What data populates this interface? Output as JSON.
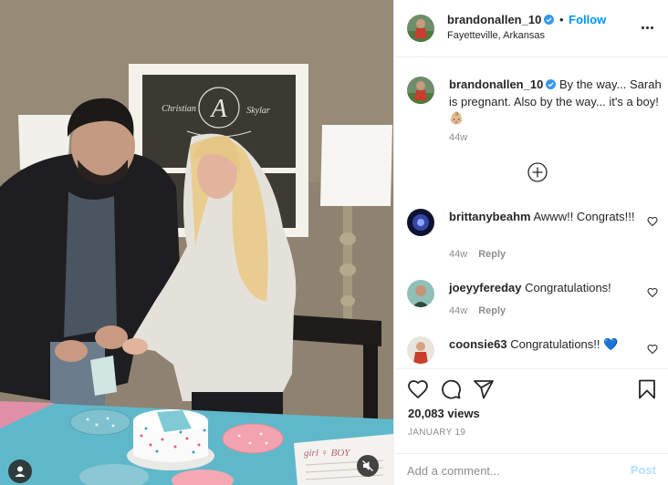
{
  "post": {
    "author": "brandonallen_10",
    "location": "Fayetteville, Arkansas",
    "follow_label": "Follow",
    "caption": "By the way... Sarah is pregnant. Also by the way... it's a boy! 👶🏼",
    "caption_time": "44w",
    "views": "20,083 views",
    "date": "JANUARY 19"
  },
  "scene_text": {
    "sign_left": "Christian",
    "sign_letter": "A",
    "sign_right": "Skylar",
    "card_text": "girl ♀ BOY"
  },
  "comments": [
    {
      "user": "brittanybeahm",
      "text": "Awww!! Congrats!!!",
      "time": "44w",
      "reply_label": "Reply"
    },
    {
      "user": "joeyyfereday",
      "text": "Congratulations!",
      "time": "44w",
      "reply_label": "Reply"
    },
    {
      "user": "coonsie63",
      "text": "Congratulations!! 💙",
      "time": "",
      "reply_label": ""
    }
  ],
  "add_comment": {
    "placeholder": "Add a comment...",
    "post_label": "Post"
  },
  "colors": {
    "accent": "#0095f6",
    "post_disabled": "#b2dffc",
    "muted": "#8e8e8e",
    "text": "#262626"
  },
  "icons": [
    "more-icon",
    "verified-icon",
    "load-more-icon",
    "heart-icon",
    "comment-icon",
    "share-icon",
    "bookmark-icon",
    "mute-icon",
    "tag-user-icon"
  ]
}
